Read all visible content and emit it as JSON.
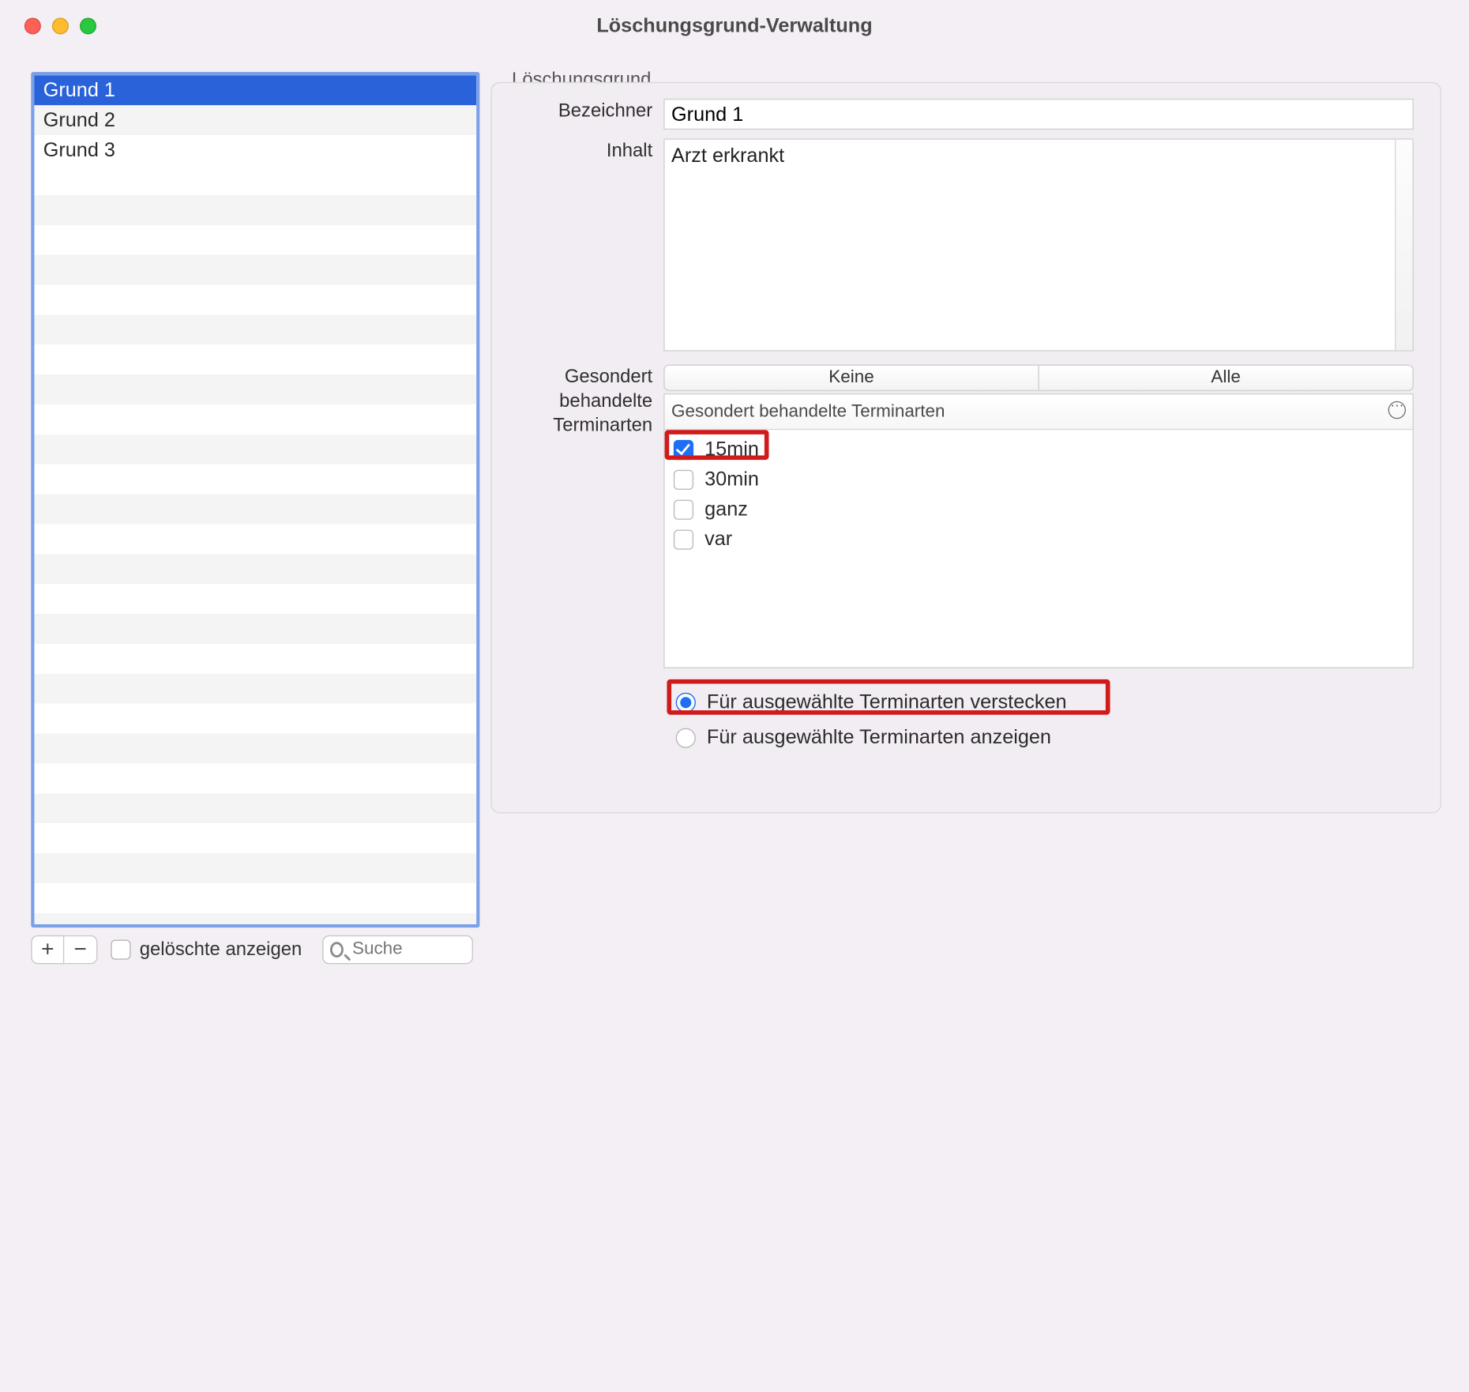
{
  "window": {
    "title": "Löschungsgrund-Verwaltung"
  },
  "list": {
    "items": [
      "Grund 1",
      "Grund 2",
      "Grund 3"
    ],
    "selected_index": 0
  },
  "list_toolbar": {
    "show_deleted_label": "gelöschte anzeigen",
    "show_deleted_checked": false,
    "search_placeholder": "Suche"
  },
  "group": {
    "legend": "Löschungsgrund",
    "fields": {
      "bezeichner_label": "Bezeichner",
      "bezeichner_value": "Grund 1",
      "inhalt_label": "Inhalt",
      "inhalt_value": "Arzt erkrankt",
      "terminarten_label_line1": "Gesondert",
      "terminarten_label_line2": "behandelte",
      "terminarten_label_line3": "Terminarten"
    },
    "segmented": {
      "none": "Keine",
      "all": "Alle"
    },
    "apt_header": "Gesondert behandelte Terminarten",
    "apt_options": [
      {
        "label": "15min",
        "checked": true
      },
      {
        "label": "30min",
        "checked": false
      },
      {
        "label": "ganz",
        "checked": false
      },
      {
        "label": "var",
        "checked": false
      }
    ],
    "radios": {
      "hide_label": "Für ausgewählte Terminarten verstecken",
      "show_label": "Für ausgewählte Terminarten anzeigen",
      "selected": "hide"
    }
  }
}
